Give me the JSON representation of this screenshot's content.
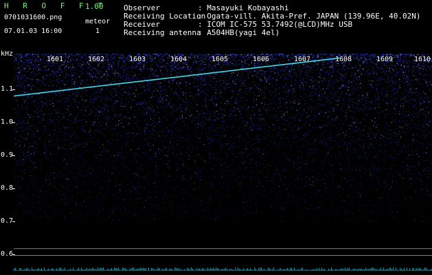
{
  "header": {
    "app_name": "H R O F F T",
    "version": "1.00",
    "filename": "0701031600.png",
    "datetime": "07.01.03 16:00",
    "counter_label": "meteor",
    "counter_value": "1",
    "info": [
      {
        "label": "Observer",
        "value": ": Masayuki Kobayashi"
      },
      {
        "label": "Receiving Location",
        "value": ": Ogata-vill. Akita-Pref. JAPAN (139.96E, 40.02N)"
      },
      {
        "label": "Receiver",
        "value": ": ICOM IC-575 53.7492(@LCD)MHz USB"
      },
      {
        "label": "Receiving antenna",
        "value": ": A504HB(yagi 4el)"
      }
    ]
  },
  "chart_data": {
    "type": "heatmap",
    "ylabel": "kHz",
    "ylim": [
      0.58,
      1.2
    ],
    "yticks": [
      "1.1",
      "1.0",
      "0.9",
      "0.8",
      "0.7",
      "0.6"
    ],
    "time_labels": [
      "1601",
      "1602",
      "1603",
      "1604",
      "1605",
      "1606",
      "1607",
      "1608",
      "1609",
      "1610"
    ],
    "meteor_trace": {
      "start_time": 1600.0,
      "end_time": 1607.9,
      "start_khz": 1.08,
      "end_khz": 1.195
    },
    "colors": {
      "background": "#000000",
      "noise": "#2a3bd8",
      "trace": "#3fd9e8",
      "grid": "#aaaaaa"
    }
  }
}
